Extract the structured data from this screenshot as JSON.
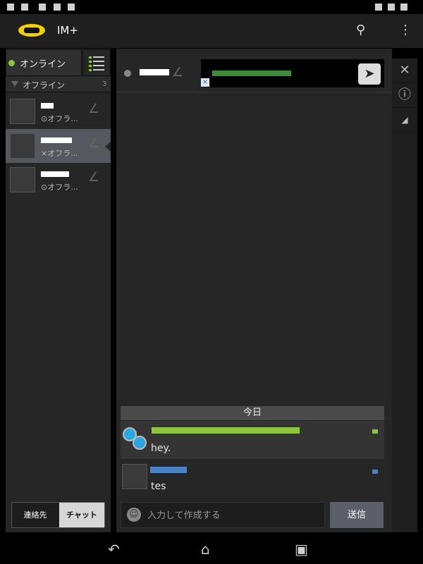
{
  "app": {
    "title": "IM+"
  },
  "presence": {
    "status": "オンライン"
  },
  "group": {
    "label": "オフライン",
    "count": "3"
  },
  "contacts": [
    {
      "status": "オフラ..."
    },
    {
      "status": "オフラ..."
    },
    {
      "status": "オフラ..."
    }
  ],
  "tabs": {
    "contacts": "連絡先",
    "chat": "チャット"
  },
  "chat": {
    "date_separator": "今日",
    "messages": [
      {
        "text": "hey."
      },
      {
        "text": "tes"
      }
    ],
    "compose_placeholder": "入力して作成する",
    "send_label": "送信"
  },
  "colors": {
    "online": "#8cc63f",
    "accent_blue": "#4a84c8"
  }
}
